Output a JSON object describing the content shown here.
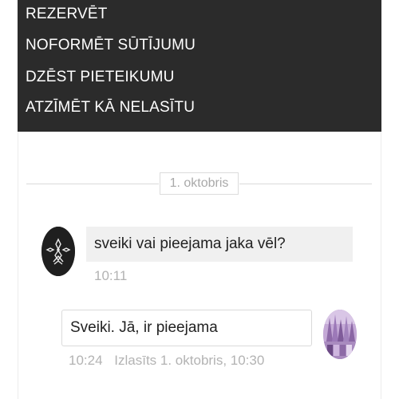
{
  "context_menu": {
    "items": [
      {
        "label": "REZERVĒT"
      },
      {
        "label": "NOFORMĒT SŪTĪJUMU"
      },
      {
        "label": "DZĒST PIETEIKUMU"
      },
      {
        "label": "ATZĪMĒT KĀ NELASĪTU"
      }
    ]
  },
  "conversation": {
    "date_divider": "1. oktobris",
    "messages": [
      {
        "direction": "incoming",
        "avatar_icon": "seller-logo-icon",
        "text": "sveiki vai pieejama jaka vēl?",
        "time": "10:11"
      },
      {
        "direction": "outgoing",
        "avatar_icon": "user-photo-avatar",
        "text": "Sveiki. Jā, ir pieejama",
        "time": "10:24",
        "read_status": "Izlasīts 1. oktobris, 10:30"
      }
    ]
  },
  "colors": {
    "menu_background": "#2b2b2b",
    "menu_text": "#ffffff",
    "incoming_bubble": "#f0f0f0",
    "meta_text": "#b3b3b3"
  }
}
